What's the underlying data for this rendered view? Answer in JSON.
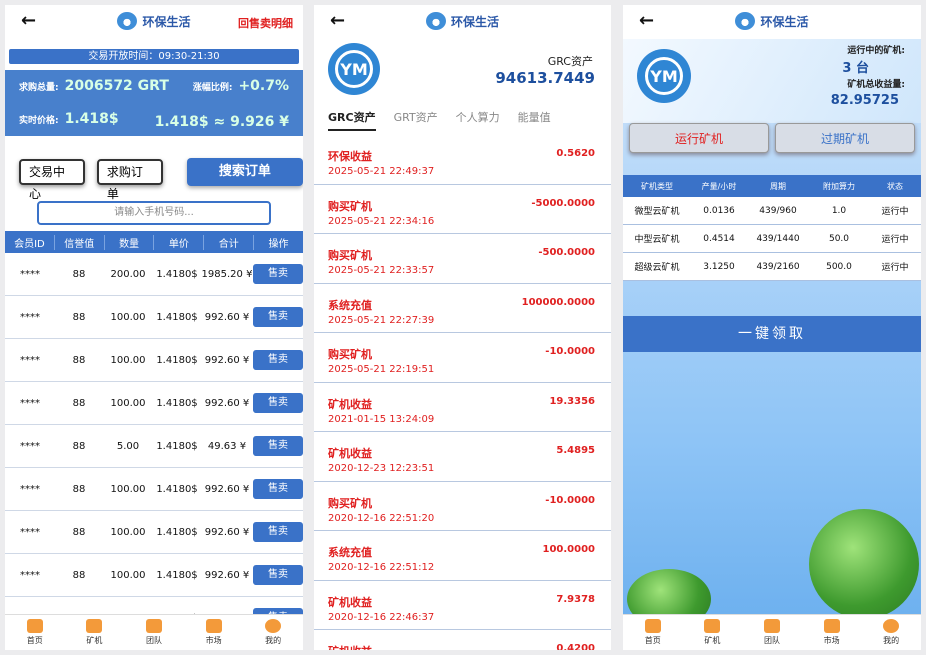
{
  "brand": "环保生活",
  "back": "←",
  "p1": {
    "top_right": "回售卖明细",
    "hours": "交易开放时间：09:30-21:30",
    "total_label": "求购总量:",
    "total_value": "2006572 GRT",
    "change_label": "涨幅比例:",
    "change_value": "+0.7%",
    "price_label": "实时价格:",
    "price_value": "1.418$",
    "price_rmb": "1.418$ ≈ 9.926 ¥",
    "btn_trade": "交易中心",
    "btn_orders": "求购订单",
    "btn_search": "搜索订单",
    "phone_placeholder": "请输入手机号码...",
    "headers": [
      "会员ID",
      "信誉值",
      "数量",
      "单价",
      "合计",
      "操作"
    ],
    "sell_label": "售卖",
    "rows": [
      [
        "****",
        "88",
        "200.00",
        "1.4180$",
        "1985.20 ¥"
      ],
      [
        "****",
        "88",
        "100.00",
        "1.4180$",
        "992.60 ¥"
      ],
      [
        "****",
        "88",
        "100.00",
        "1.4180$",
        "992.60 ¥"
      ],
      [
        "****",
        "88",
        "100.00",
        "1.4180$",
        "992.60 ¥"
      ],
      [
        "****",
        "88",
        "5.00",
        "1.4180$",
        "49.63 ¥"
      ],
      [
        "****",
        "88",
        "100.00",
        "1.4180$",
        "992.60 ¥"
      ],
      [
        "****",
        "88",
        "100.00",
        "1.4180$",
        "992.60 ¥"
      ],
      [
        "****",
        "88",
        "100.00",
        "1.4180$",
        "992.60 ¥"
      ],
      [
        "****",
        "88",
        "100.00",
        "1.4180$",
        "992.60 ¥"
      ]
    ]
  },
  "tabbar": [
    "首页",
    "矿机",
    "团队",
    "市场",
    "我的"
  ],
  "p2": {
    "avatar_text": "YM",
    "asset_label": "GRC资产",
    "asset_value": "94613.7449",
    "tabs": [
      "GRC资产",
      "GRT资产",
      "个人算力",
      "能量值"
    ],
    "items": [
      {
        "name": "环保收益",
        "amount": "0.5620",
        "date": "2025-05-21 22:49:37"
      },
      {
        "name": "购买矿机",
        "amount": "-5000.0000",
        "date": "2025-05-21 22:34:16"
      },
      {
        "name": "购买矿机",
        "amount": "-500.0000",
        "date": "2025-05-21 22:33:57"
      },
      {
        "name": "系统充值",
        "amount": "100000.0000",
        "date": "2025-05-21 22:27:39"
      },
      {
        "name": "购买矿机",
        "amount": "-10.0000",
        "date": "2025-05-21 22:19:51"
      },
      {
        "name": "矿机收益",
        "amount": "19.3356",
        "date": "2021-01-15 13:24:09"
      },
      {
        "name": "矿机收益",
        "amount": "5.4895",
        "date": "2020-12-23 12:23:51"
      },
      {
        "name": "购买矿机",
        "amount": "-10.0000",
        "date": "2020-12-16 22:51:20"
      },
      {
        "name": "系统充值",
        "amount": "100.0000",
        "date": "2020-12-16 22:51:12"
      },
      {
        "name": "矿机收益",
        "amount": "7.9378",
        "date": "2020-12-16 22:46:37"
      },
      {
        "name": "矿机收益",
        "amount": "0.4200",
        "date": ""
      }
    ]
  },
  "p3": {
    "running_label": "运行中的矿机:",
    "running_value": "3 台",
    "earn_label": "矿机总收益量:",
    "earn_value": "82.95725",
    "tab_running": "运行矿机",
    "tab_expired": "过期矿机",
    "headers": [
      "矿机类型",
      "产量/小时",
      "周期",
      "附加算力",
      "状态"
    ],
    "rows": [
      [
        "微型云矿机",
        "0.0136",
        "439/960",
        "1.0",
        "运行中"
      ],
      [
        "中型云矿机",
        "0.4514",
        "439/1440",
        "50.0",
        "运行中"
      ],
      [
        "超级云矿机",
        "3.1250",
        "439/2160",
        "500.0",
        "运行中"
      ]
    ],
    "claim": "一键领取"
  }
}
